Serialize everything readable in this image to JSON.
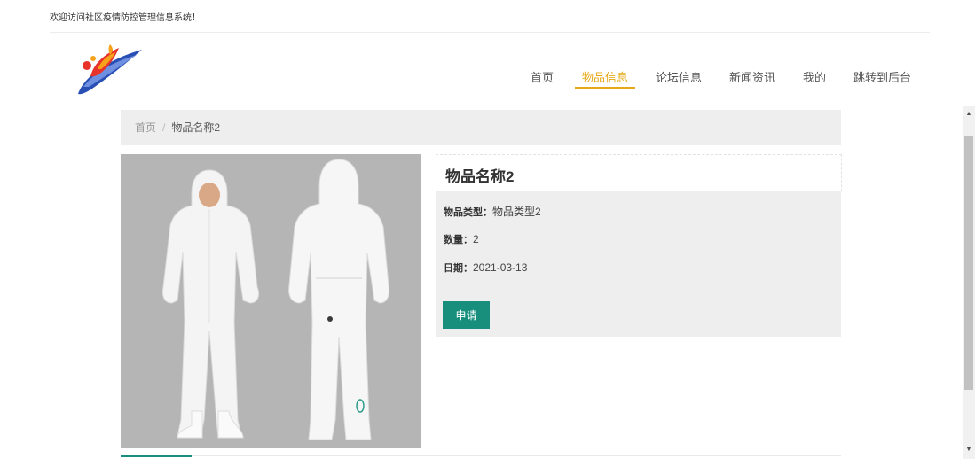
{
  "header": {
    "welcome_text": "欢迎访问社区疫情防控管理信息系统！",
    "logo_icon": "logo-swoosh-icon"
  },
  "nav": {
    "items": [
      {
        "label": "首页",
        "active": false
      },
      {
        "label": "物品信息",
        "active": true
      },
      {
        "label": "论坛信息",
        "active": false
      },
      {
        "label": "新闻资讯",
        "active": false
      },
      {
        "label": "我的",
        "active": false
      },
      {
        "label": "跳转到后台",
        "active": false
      }
    ],
    "active_color": "#e6a817"
  },
  "breadcrumb": {
    "home": "首页",
    "separator": "/",
    "current": "物品名称2"
  },
  "product": {
    "image_alt": "white protective suit front and back",
    "title": "物品名称2",
    "type_label": "物品类型：",
    "type_value": "物品类型2",
    "quantity_label": "数量：",
    "quantity_value": "2",
    "date_label": "日期：",
    "date_value": "2021-03-13",
    "apply_button": "申请"
  },
  "colors": {
    "accent": "#178f7c",
    "panel_bg": "#eeeeee"
  }
}
